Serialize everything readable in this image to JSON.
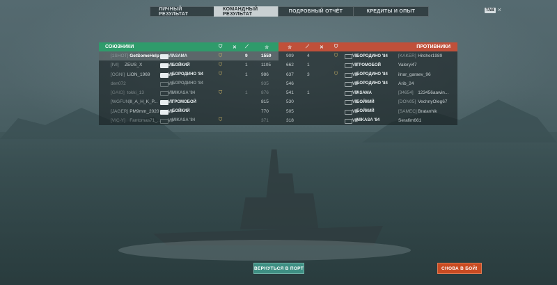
{
  "tabs": [
    {
      "label": "ЛИЧНЫЙ РЕЗУЛЬТАТ",
      "active": false
    },
    {
      "label": "КОМАНДНЫЙ РЕЗУЛЬТАТ",
      "active": true
    },
    {
      "label": "ПОДРОБНЫЙ ОТЧЁТ",
      "active": false
    },
    {
      "label": "КРЕДИТЫ И ОПЫТ",
      "active": false
    }
  ],
  "corner": {
    "badge": "TAB",
    "close": "×"
  },
  "allies": {
    "title": "СОЮЗНИКИ",
    "color": "#2f9b6b",
    "rows": [
      {
        "clan": "[1SHOT]",
        "player": "GetSomeHelp",
        "level": "Ⅷ",
        "ship": "ASAMA",
        "survived": true,
        "medal": true,
        "kills": "9",
        "score": "1559",
        "highlight": true
      },
      {
        "clan": "[IVI]",
        "player": "ZEUS_X",
        "level": "Ⅷ",
        "ship": "БОЙКИЙ",
        "survived": true,
        "medal": true,
        "kills": "1",
        "score": "1105"
      },
      {
        "clan": "[OGNI]",
        "player": "LiON_1969",
        "level": "Ⅷ",
        "ship": "БОРОДИНО '84",
        "survived": true,
        "medal": true,
        "kills": "1",
        "score": "986"
      },
      {
        "clan": "",
        "player": "den072",
        "level": "Ⅷ",
        "ship": "БОРОДИНО '84",
        "survived": false,
        "medal": false,
        "kills": "",
        "score": "935"
      },
      {
        "clan": "[GAIO]",
        "player": "tokki_13",
        "level": "Ⅷ",
        "ship": "MIKASA '84",
        "survived": false,
        "medal": true,
        "kills": "1",
        "score": "876"
      },
      {
        "clan": "[WGFUN]",
        "player": "II_A_H_K_P...",
        "level": "Ⅷ",
        "ship": "ГРОМОБОЙ",
        "survived": true,
        "medal": false,
        "kills": "",
        "score": "815"
      },
      {
        "clan": "[JAGER]",
        "player": "PM9mm_2020",
        "level": "Ⅷ",
        "ship": "БОЙКИЙ",
        "survived": true,
        "medal": false,
        "kills": "",
        "score": "770"
      },
      {
        "clan": "[VIC-Y]",
        "player": "Fantomas71_...",
        "level": "Ⅷ",
        "ship": "MIKASA '84",
        "survived": false,
        "medal": true,
        "kills": "",
        "score": "371"
      }
    ]
  },
  "enemies": {
    "title": "ПРОТИВНИКИ",
    "color": "#c0503a",
    "rows": [
      {
        "clan": "[KAKER]",
        "player": "Hitcher1989",
        "level": "Ⅷ",
        "ship": "БОРОДИНО '84",
        "medal": true,
        "score": "909",
        "kills": "4"
      },
      {
        "clan": "",
        "player": "Valeryi47",
        "level": "Ⅷ",
        "ship": "ГРОМОБОЙ",
        "medal": false,
        "score": "662",
        "kills": "1"
      },
      {
        "clan": "",
        "player": "ilnar_garaev_96",
        "level": "Ⅷ",
        "ship": "БОРОДИНО '84",
        "medal": true,
        "score": "637",
        "kills": "3"
      },
      {
        "clan": "",
        "player": "Arib_24",
        "level": "Ⅷ",
        "ship": "БОРОДИНО '84",
        "medal": false,
        "score": "546",
        "kills": ""
      },
      {
        "clan": "[34654]",
        "player": "123456aawin...",
        "level": "Ⅷ",
        "ship": "ASAMA",
        "medal": false,
        "score": "541",
        "kills": "1"
      },
      {
        "clan": "[DON05]",
        "player": "VechnyOleg67",
        "level": "Ⅷ",
        "ship": "БОЙКИЙ",
        "medal": false,
        "score": "530",
        "kills": ""
      },
      {
        "clan": "[SAMEC]",
        "player": "Bratanhik",
        "level": "Ⅷ",
        "ship": "БОЙКИЙ",
        "medal": false,
        "score": "505",
        "kills": ""
      },
      {
        "clan": "",
        "player": "Serafim661",
        "level": "Ⅷ",
        "ship": "MIKASA '84",
        "medal": false,
        "score": "318",
        "kills": ""
      }
    ]
  },
  "buttons": {
    "port": "ВЕРНУТЬСЯ В ПОРТ",
    "battle": "СНОВА В БОЙ!"
  }
}
